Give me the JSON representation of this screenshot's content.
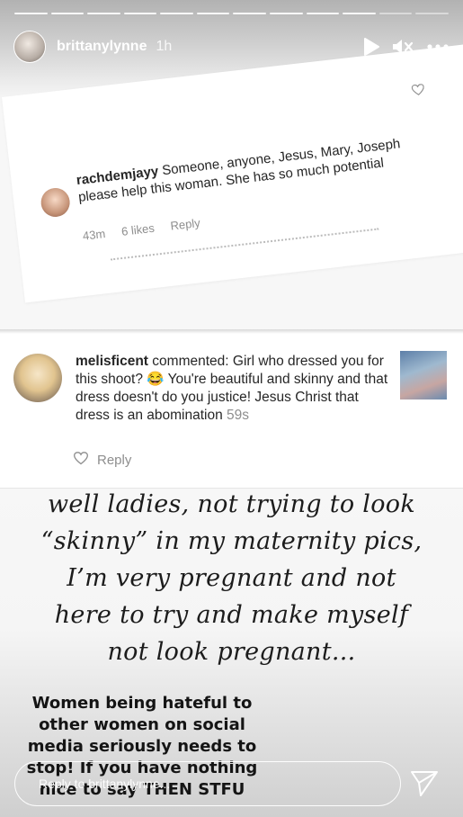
{
  "header": {
    "username": "brittanylynne",
    "time": "1h"
  },
  "progress": {
    "segments": 12,
    "active": 10
  },
  "comment1": {
    "username": "rachdemjayy",
    "text": "Someone, anyone, Jesus, Mary, Joseph please help this woman. She has so much potential",
    "time": "43m",
    "likes": "6 likes",
    "reply": "Reply"
  },
  "comment2": {
    "username": "melisficent",
    "action": "commented:",
    "text": "Girl who dressed you for this shoot? 😂 You're beautiful and skinny and that dress doesn't do you justice! Jesus Christ that dress is an abomination",
    "time": "59s",
    "reply": "Reply"
  },
  "script_lines": [
    "well ladies, not trying to look",
    "“skinny” in my maternity pics,",
    "I’m very pregnant and not",
    "here to try and make myself",
    "not look pregnant..."
  ],
  "caption_lines": [
    "Women being hateful to",
    "other women on social",
    "media seriously needs to",
    "stop! If you have nothing",
    "nice to say THEN STFU"
  ],
  "reply_bar": {
    "placeholder": "Reply to brittanylynne..."
  },
  "icons": {
    "play": "play-icon",
    "mute": "mute-icon",
    "more": "more-icon",
    "heart": "heart-icon",
    "send": "send-icon"
  }
}
